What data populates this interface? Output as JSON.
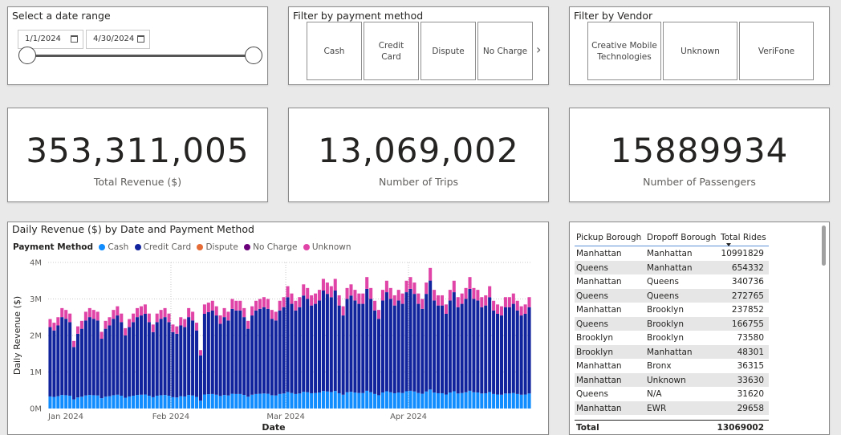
{
  "date_slicer": {
    "title": "Select a date range",
    "start": "1/1/2024",
    "end": "4/30/2024"
  },
  "payment_slicer": {
    "title": "Filter by payment method",
    "tiles": [
      "Cash",
      "Credit Card",
      "Dispute",
      "No Charge"
    ]
  },
  "vendor_slicer": {
    "title": "Filter by Vendor",
    "tiles": [
      "Creative Mobile Technologies",
      "Unknown",
      "VeriFone"
    ]
  },
  "kpis": {
    "revenue": {
      "value": "353,311,005",
      "label": "Total Revenue ($)"
    },
    "trips": {
      "value": "13,069,002",
      "label": "Number of Trips"
    },
    "passengers": {
      "value": "15889934",
      "label": "Number of Passengers"
    }
  },
  "chart": {
    "title": "Daily Revenue ($) by Date and Payment Method",
    "legend_title": "Payment Method",
    "legend": [
      {
        "name": "Cash",
        "color": "#118dff"
      },
      {
        "name": "Credit Card",
        "color": "#12239e"
      },
      {
        "name": "Dispute",
        "color": "#e66c37"
      },
      {
        "name": "No Charge",
        "color": "#6b007b"
      },
      {
        "name": "Unknown",
        "color": "#e044a7"
      }
    ]
  },
  "chart_data": {
    "type": "bar",
    "stacked": true,
    "title": "Daily Revenue ($) by Date and Payment Method",
    "xlabel": "Date",
    "ylabel": "Daily Revenue ($)",
    "ylim": [
      0,
      4000000
    ],
    "yticks": [
      "0M",
      "1M",
      "2M",
      "3M",
      "4M"
    ],
    "xticks": [
      "Jan 2024",
      "Feb 2024",
      "Mar 2024",
      "Apr 2024"
    ],
    "x_start": "2024-01-01",
    "series": [
      {
        "name": "Cash",
        "color": "#118dff"
      },
      {
        "name": "Credit Card",
        "color": "#12239e"
      },
      {
        "name": "Unknown",
        "color": "#e044a7"
      }
    ],
    "totals": [
      2.45,
      2.35,
      2.5,
      2.75,
      2.7,
      2.6,
      1.85,
      2.25,
      2.4,
      2.65,
      2.75,
      2.7,
      2.65,
      2.1,
      2.4,
      2.5,
      2.7,
      2.8,
      2.6,
      2.2,
      2.45,
      2.6,
      2.75,
      2.8,
      2.85,
      2.6,
      2.3,
      2.6,
      2.7,
      2.75,
      2.6,
      2.3,
      2.25,
      2.5,
      2.45,
      2.75,
      2.65,
      2.35,
      1.6,
      2.85,
      2.9,
      2.95,
      2.8,
      2.55,
      2.75,
      2.65,
      3.0,
      2.95,
      2.95,
      2.75,
      2.4,
      2.8,
      2.95,
      3.0,
      3.05,
      3.0,
      2.7,
      2.65,
      2.95,
      3.05,
      3.35,
      3.15,
      2.95,
      3.05,
      3.4,
      3.3,
      3.1,
      3.15,
      3.25,
      3.55,
      3.45,
      3.35,
      3.55,
      3.1,
      2.8,
      3.3,
      3.4,
      3.25,
      3.15,
      3.15,
      3.6,
      3.3,
      2.95,
      2.7,
      3.25,
      3.5,
      3.3,
      3.1,
      3.25,
      3.15,
      3.5,
      3.6,
      3.45,
      3.15,
      3.0,
      3.45,
      3.85,
      3.25,
      3.1,
      3.1,
      2.85,
      3.25,
      3.5,
      3.05,
      3.15,
      3.3,
      3.6,
      3.3,
      3.25,
      3.05,
      3.1,
      3.35,
      2.95,
      2.85,
      2.8,
      3.05,
      3.05,
      3.15,
      2.95,
      2.8,
      2.85,
      3.05
    ],
    "cash_share": 0.135,
    "unknown_share": 0.09
  },
  "table": {
    "headers": [
      "Pickup Borough",
      "Dropoff Borough",
      "Total Rides"
    ],
    "rows": [
      [
        "Manhattan",
        "Manhattan",
        "10991829"
      ],
      [
        "Queens",
        "Manhattan",
        "654332"
      ],
      [
        "Manhattan",
        "Queens",
        "340736"
      ],
      [
        "Queens",
        "Queens",
        "272765"
      ],
      [
        "Manhattan",
        "Brooklyn",
        "237852"
      ],
      [
        "Queens",
        "Brooklyn",
        "166755"
      ],
      [
        "Brooklyn",
        "Brooklyn",
        "73580"
      ],
      [
        "Brooklyn",
        "Manhattan",
        "48301"
      ],
      [
        "Manhattan",
        "Bronx",
        "36315"
      ],
      [
        "Manhattan",
        "Unknown",
        "33630"
      ],
      [
        "Queens",
        "N/A",
        "31620"
      ],
      [
        "Manhattan",
        "EWR",
        "29658"
      ]
    ],
    "total_label": "Total",
    "total_value": "13069002"
  }
}
